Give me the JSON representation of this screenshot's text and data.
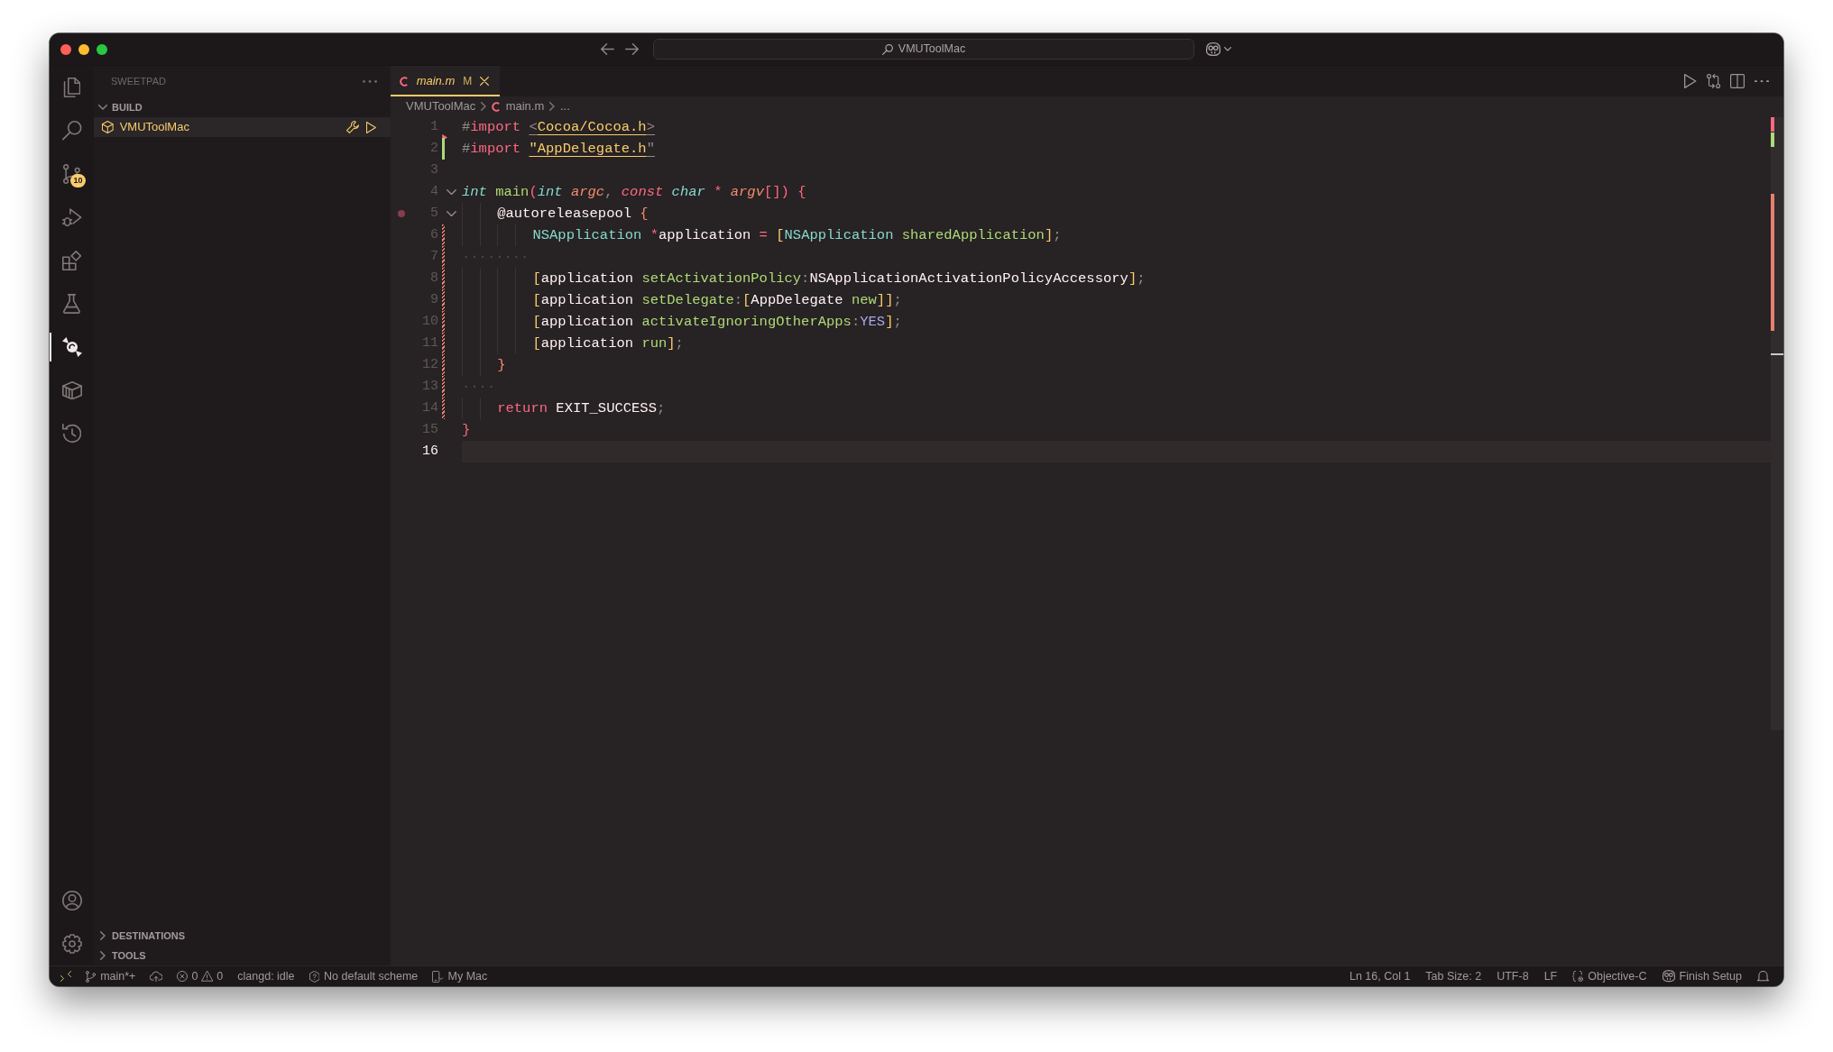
{
  "title_bar": {
    "command_center": "VMUToolMac"
  },
  "activity_bar": {
    "top": [
      {
        "kind": "files",
        "selected": false
      },
      {
        "kind": "search",
        "selected": false
      },
      {
        "kind": "branches",
        "selected": false,
        "badge": "10"
      },
      {
        "kind": "debug",
        "selected": false
      },
      {
        "kind": "blocks",
        "selected": false
      },
      {
        "kind": "flask",
        "selected": false
      },
      {
        "kind": "candy",
        "selected": true
      },
      {
        "kind": "crate",
        "selected": false
      },
      {
        "kind": "history",
        "selected": false
      }
    ],
    "bottom": [
      {
        "kind": "account"
      },
      {
        "kind": "gear"
      }
    ]
  },
  "sidebar": {
    "title": "SWEETPAD",
    "sections": [
      {
        "title": "BUILD",
        "expanded": true,
        "items": [
          {
            "label": "VMUToolMac",
            "selected": true
          }
        ]
      },
      {
        "title": "DESTINATIONS",
        "expanded": false
      },
      {
        "title": "TOOLS",
        "expanded": false
      }
    ]
  },
  "tabs": [
    {
      "label": "main.m",
      "selected": true,
      "preview": true,
      "git_status": "M"
    }
  ],
  "breadcrumbs": [
    {
      "kind": "folder",
      "label": "VMUToolMac"
    },
    {
      "kind": "file",
      "label": "main.m"
    },
    {
      "kind": "symbol",
      "label": "..."
    }
  ],
  "editor": {
    "lines": [
      {
        "number": "1",
        "deleted": true,
        "tokens": [
          {
            "kind": "punct",
            "text": "#"
          },
          {
            "kind": "keyword",
            "text": "import "
          },
          {
            "kind": "punct",
            "text": "<",
            "link": true
          },
          {
            "kind": "string",
            "text": "Cocoa/Cocoa.h",
            "link": true
          },
          {
            "kind": "punct",
            "text": ">",
            "link": true
          }
        ]
      },
      {
        "number": "2",
        "added": true,
        "tokens": [
          {
            "kind": "punct",
            "text": "#"
          },
          {
            "kind": "keyword",
            "text": "import "
          },
          {
            "kind": "string",
            "text": "\"AppDelegate.h",
            "link": true
          },
          {
            "kind": "punct",
            "text": "\"",
            "link": true
          }
        ]
      },
      {
        "number": "3"
      },
      {
        "number": "4",
        "expanded": true,
        "tokens": [
          {
            "kind": "type",
            "text": "int "
          },
          {
            "kind": "function",
            "text": "main"
          },
          {
            "kind": "paren",
            "text": "("
          },
          {
            "kind": "type",
            "text": "int "
          },
          {
            "kind": "parameter",
            "text": "argc"
          },
          {
            "kind": "punct",
            "text": ", "
          },
          {
            "kind": "storage",
            "text": "const "
          },
          {
            "kind": "type",
            "text": "char "
          },
          {
            "kind": "operator",
            "text": "* "
          },
          {
            "kind": "parameter",
            "text": "argv"
          },
          {
            "kind": "paren",
            "text": "[]) {"
          }
        ]
      },
      {
        "number": "5",
        "breakpoint": true,
        "expanded": true,
        "tokens": [
          {
            "kind": "plain",
            "text": "    @autoreleasepool "
          },
          {
            "kind": "brace",
            "text": "{"
          }
        ]
      },
      {
        "number": "6",
        "modified": true,
        "tokens": [
          {
            "kind": "class",
            "text": "        NSApplication "
          },
          {
            "kind": "operator",
            "text": "*"
          },
          {
            "kind": "plain",
            "text": "application "
          },
          {
            "kind": "operator",
            "text": "= "
          },
          {
            "kind": "bracket",
            "text": "["
          },
          {
            "kind": "class",
            "text": "NSApplication "
          },
          {
            "kind": "function",
            "text": "sharedApplication"
          },
          {
            "kind": "bracket",
            "text": "]"
          },
          {
            "kind": "punct",
            "text": ";"
          }
        ]
      },
      {
        "number": "7",
        "modified": true,
        "tokens": [
          {
            "kind": "whitespace",
            "text": "········"
          }
        ]
      },
      {
        "number": "8",
        "modified": true,
        "tokens": [
          {
            "kind": "bracket",
            "text": "        ["
          },
          {
            "kind": "plain",
            "text": "application "
          },
          {
            "kind": "function",
            "text": "setActivationPolicy"
          },
          {
            "kind": "punct",
            "text": ":"
          },
          {
            "kind": "plain",
            "text": "NSApplicationActivationPolicyAccessory"
          },
          {
            "kind": "bracket",
            "text": "]"
          },
          {
            "kind": "punct",
            "text": ";"
          }
        ]
      },
      {
        "number": "9",
        "modified": true,
        "tokens": [
          {
            "kind": "bracket",
            "text": "        ["
          },
          {
            "kind": "plain",
            "text": "application "
          },
          {
            "kind": "function",
            "text": "setDelegate"
          },
          {
            "kind": "punct",
            "text": ":"
          },
          {
            "kind": "bracket",
            "text": "["
          },
          {
            "kind": "plain",
            "text": "AppDelegate "
          },
          {
            "kind": "function",
            "text": "new"
          },
          {
            "kind": "bracket",
            "text": "]]"
          },
          {
            "kind": "punct",
            "text": ";"
          }
        ]
      },
      {
        "number": "10",
        "modified": true,
        "tokens": [
          {
            "kind": "bracket",
            "text": "        ["
          },
          {
            "kind": "plain",
            "text": "application "
          },
          {
            "kind": "function",
            "text": "activateIgnoringOtherApps"
          },
          {
            "kind": "punct",
            "text": ":"
          },
          {
            "kind": "constant",
            "text": "YES"
          },
          {
            "kind": "bracket",
            "text": "]"
          },
          {
            "kind": "punct",
            "text": ";"
          }
        ]
      },
      {
        "number": "11",
        "modified": true,
        "tokens": [
          {
            "kind": "bracket",
            "text": "        ["
          },
          {
            "kind": "plain",
            "text": "application "
          },
          {
            "kind": "function",
            "text": "run"
          },
          {
            "kind": "bracket",
            "text": "]"
          },
          {
            "kind": "punct",
            "text": ";"
          }
        ]
      },
      {
        "number": "12",
        "modified": true,
        "tokens": [
          {
            "kind": "brace",
            "text": "    }"
          }
        ]
      },
      {
        "number": "13",
        "modified": true,
        "tokens": [
          {
            "kind": "whitespace",
            "text": "····"
          }
        ]
      },
      {
        "number": "14",
        "modified": true,
        "tokens": [
          {
            "kind": "keyword",
            "text": "    return "
          },
          {
            "kind": "plain",
            "text": "EXIT_SUCCESS"
          },
          {
            "kind": "punct",
            "text": ";"
          }
        ]
      },
      {
        "number": "15",
        "tokens": [
          {
            "kind": "paren",
            "text": "}"
          }
        ]
      },
      {
        "number": "16",
        "current": true
      }
    ]
  },
  "status_bar": {
    "left": [
      {
        "kind": "remote"
      },
      {
        "kind": "branch",
        "text": "main*+"
      },
      {
        "kind": "publish"
      },
      {
        "kind": "problems",
        "errors": "0",
        "warnings": "0"
      },
      {
        "kind": "text",
        "text": "clangd: idle"
      },
      {
        "kind": "scheme",
        "text": "No default scheme"
      },
      {
        "kind": "device",
        "text": "My Mac"
      }
    ],
    "right": [
      {
        "kind": "text",
        "text": "Ln 16, Col 1"
      },
      {
        "kind": "text",
        "text": "Tab Size: 2"
      },
      {
        "kind": "text",
        "text": "UTF-8"
      },
      {
        "kind": "text",
        "text": "LF"
      },
      {
        "kind": "language",
        "text": "Objective-C"
      },
      {
        "kind": "copilot",
        "text": "Finish Setup"
      },
      {
        "kind": "notifications"
      }
    ]
  }
}
